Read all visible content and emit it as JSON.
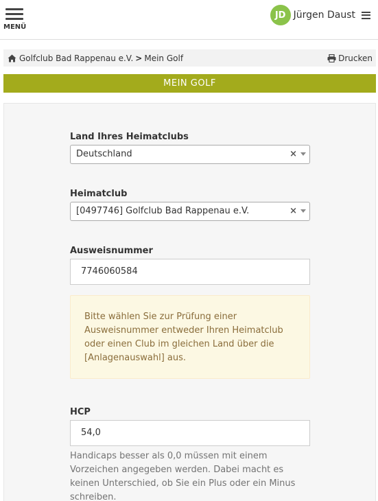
{
  "header": {
    "menu_label": "MENÜ",
    "user_initials": "JD",
    "user_name": "Jürgen Daust"
  },
  "breadcrumb": {
    "club": "Golfclub Bad Rappenau e.V.",
    "separator": ">",
    "page": "Mein Golf",
    "print_label": "Drucken"
  },
  "title": "MEIN GOLF",
  "form": {
    "country": {
      "label": "Land Ihres Heimatclubs",
      "value": "Deutschland",
      "clear": "×"
    },
    "homeclub": {
      "label": "Heimatclub",
      "value": "[0497746] Golfclub Bad Rappenau e.V.",
      "clear": "×"
    },
    "id_number": {
      "label": "Ausweisnummer",
      "value": "7746060584"
    },
    "notice": "Bitte wählen Sie zur Prüfung einer Ausweisnummer entweder Ihren Heimatclub oder einen Club im gleichen Land über die [Anlagenauswahl] aus.",
    "hcp": {
      "label": "HCP",
      "value": "54,0",
      "help": "Handicaps besser als 0,0 müssen mit einem Vorzeichen angegeben werden. Dabei macht es keinen Unterschied, ob Sie ein Plus oder ein Minus schreiben."
    }
  },
  "colors": {
    "title_bar": "#a3ab1c",
    "avatar": "#8bc34a",
    "notice_bg": "#fcf8e3",
    "notice_text": "#8a6d3b"
  },
  "icons": {
    "menu": "hamburger-icon",
    "user_menu": "hamburger-icon",
    "home": "home-icon",
    "print": "printer-icon"
  }
}
